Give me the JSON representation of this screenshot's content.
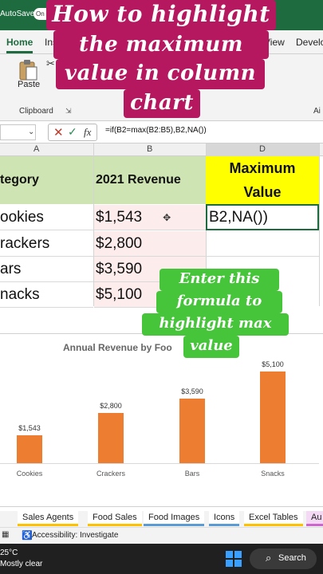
{
  "titlebar": {
    "autosave": "AutoSave",
    "toggle": "On"
  },
  "ribbon_tabs": [
    "Home",
    "Insert",
    "View",
    "Develo"
  ],
  "ribbon": {
    "paste_label": "Paste",
    "clipboard_label": "Clipboard",
    "right_label": "Ai"
  },
  "formula_bar": {
    "formula": "=if(B2=max(B2:B5),B2,NA())"
  },
  "columns": [
    "A",
    "B",
    "D"
  ],
  "headers": {
    "a": "tegory",
    "b": "2021 Revenue",
    "d_line1": "Maximum",
    "d_line2": "Value"
  },
  "rows": [
    {
      "category": "ookies",
      "revenue": "$1,543"
    },
    {
      "category": "rackers",
      "revenue": "$2,800"
    },
    {
      "category": "ars",
      "revenue": "$3,590"
    },
    {
      "category": "nacks",
      "revenue": "$5,100"
    }
  ],
  "active_cell_text": "B2,NA())",
  "chart_data": {
    "type": "bar",
    "title": "Annual Revenue by Foo",
    "categories": [
      "Cookies",
      "Crackers",
      "Bars",
      "Snacks"
    ],
    "values": [
      1543,
      2800,
      3590,
      5100
    ],
    "data_labels": [
      "$1,543",
      "$2,800",
      "$3,590",
      "$5,100"
    ],
    "ylim": [
      0,
      5600
    ],
    "color": "#ed7d31"
  },
  "sheet_tabs": [
    {
      "label": "Sales Agents",
      "color": "#ffc000"
    },
    {
      "label": "Food Sales",
      "color": "#ffc000"
    },
    {
      "label": "Food Images",
      "color": "#5b9bd5"
    },
    {
      "label": "Icons",
      "color": "#5b9bd5"
    },
    {
      "label": "Excel Tables",
      "color": "#ffc000"
    },
    {
      "label": "Au",
      "color": "#cc66cc"
    }
  ],
  "status": {
    "accessibility": "Accessibility: Investigate"
  },
  "taskbar": {
    "temp": "25°C",
    "weather": "Mostly clear",
    "search": "Search"
  },
  "captions": {
    "title_lines": [
      "How to highlight",
      "the maximum",
      "value in column",
      "chart"
    ],
    "hint_lines": [
      "Enter this",
      "formula to",
      "highlight max",
      "value"
    ]
  }
}
